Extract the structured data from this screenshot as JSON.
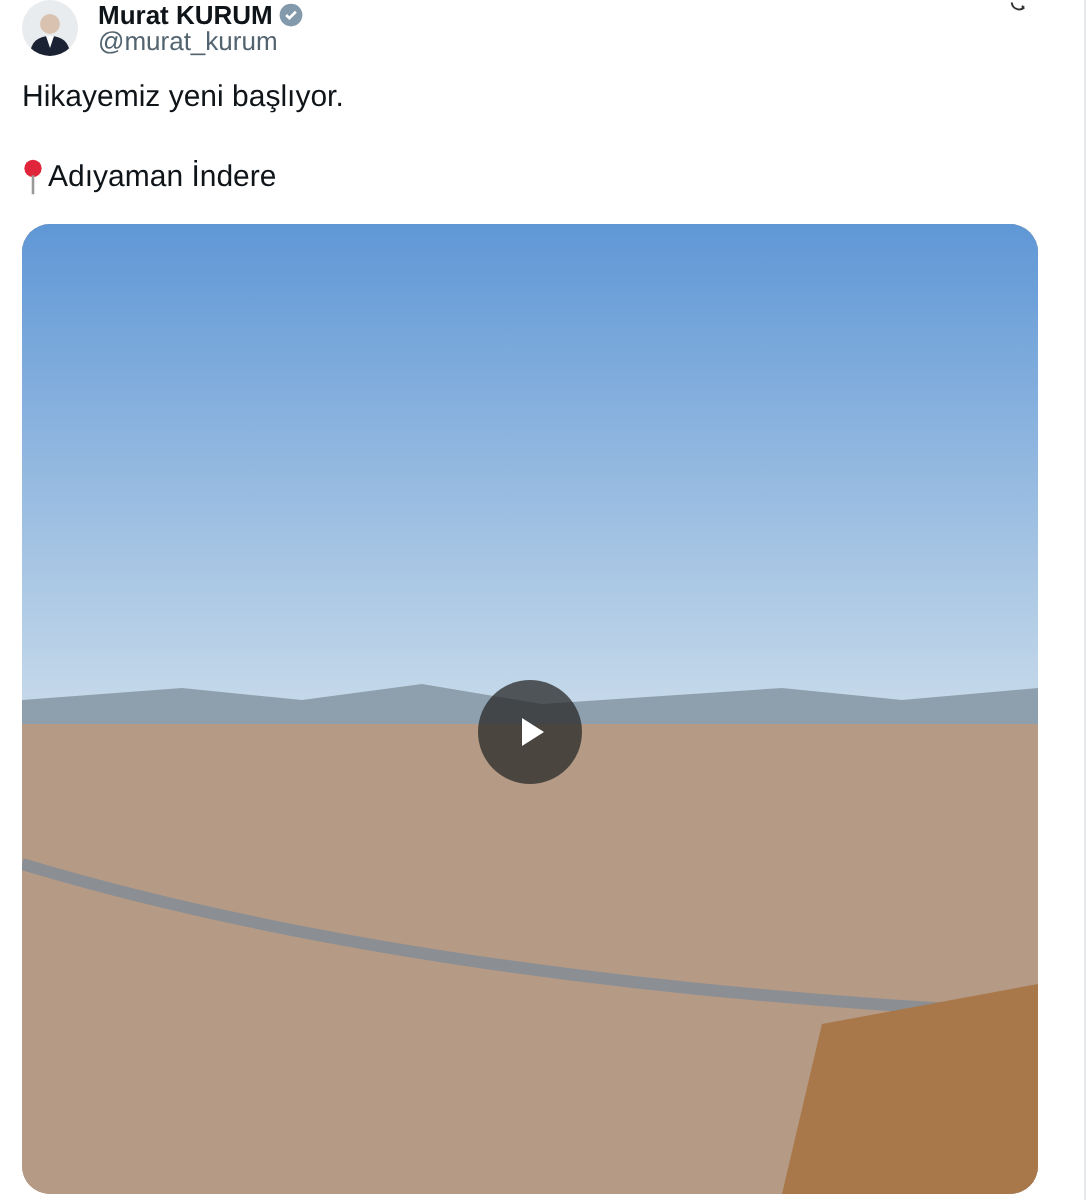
{
  "author": {
    "name": "Murat KURUM",
    "handle": "@murat_kurum",
    "verified": true
  },
  "post": {
    "lines": [
      "Hikayemiz yeni başlıyor.",
      "Adıyaman İndere"
    ]
  },
  "media": {
    "kind": "video"
  }
}
